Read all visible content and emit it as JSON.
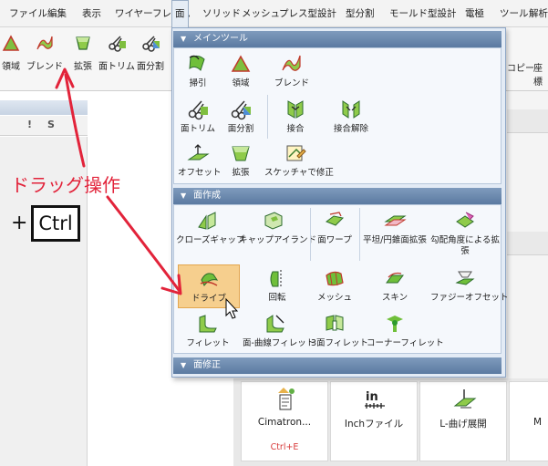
{
  "menubar": {
    "items": [
      {
        "label": "ファイル"
      },
      {
        "label": "編集"
      },
      {
        "label": "表示"
      },
      {
        "label": "ワイヤーフレーム"
      },
      {
        "label": "面"
      },
      {
        "label": "ソリッド"
      },
      {
        "label": "メッシュ"
      },
      {
        "label": "プレス型設計"
      },
      {
        "label": "型分割"
      },
      {
        "label": "モールド型設計"
      },
      {
        "label": "電極"
      },
      {
        "label": "ツール"
      },
      {
        "label": "解析"
      }
    ]
  },
  "ribbon": {
    "buttons": [
      {
        "label": "領域",
        "icon": "region-icon"
      },
      {
        "label": "ブレンド",
        "icon": "blend-icon"
      },
      {
        "label": "拡張",
        "icon": "extend-icon"
      },
      {
        "label": "面トリム",
        "icon": "face-trim-icon"
      },
      {
        "label": "面分割",
        "icon": "face-split-icon"
      }
    ],
    "right_label": "コピー",
    "right_label2": "座標"
  },
  "left_panel": {
    "tools": [
      "!",
      "S"
    ]
  },
  "dropdown": {
    "sections": [
      {
        "title": "メインツール",
        "items": [
          {
            "label": "掃引",
            "icon": "sweep-icon"
          },
          {
            "label": "領域",
            "icon": "region-icon"
          },
          {
            "label": "ブレンド",
            "icon": "blend-icon"
          },
          {
            "label": "面トリム",
            "icon": "face-trim-icon"
          },
          {
            "label": "面分割",
            "icon": "face-split-icon"
          },
          {
            "label": "接合",
            "icon": "stitch-icon"
          },
          {
            "label": "接合解除",
            "icon": "unstitch-icon"
          },
          {
            "label": "オフセット",
            "icon": "offset-icon"
          },
          {
            "label": "拡張",
            "icon": "extend-icon"
          },
          {
            "label": "スケッチャで修正",
            "icon": "sketcher-edit-icon"
          }
        ]
      },
      {
        "title": "面作成",
        "items": [
          {
            "label": "クローズギャップ",
            "icon": "close-gap-icon"
          },
          {
            "label": "キャップアイランド",
            "icon": "cap-island-icon"
          },
          {
            "label": "面ワープ",
            "icon": "face-warp-icon"
          },
          {
            "label": "平坦/円錐面拡張",
            "icon": "flat-cone-extend-icon"
          },
          {
            "label": "勾配角度による拡張",
            "icon": "draft-extend-icon"
          },
          {
            "label": "ドライブ",
            "icon": "drive-icon"
          },
          {
            "label": "回転",
            "icon": "revolve-icon"
          },
          {
            "label": "メッシュ",
            "icon": "mesh-icon"
          },
          {
            "label": "スキン",
            "icon": "skin-icon"
          },
          {
            "label": "ファジーオフセット",
            "icon": "fuzzy-offset-icon"
          },
          {
            "label": "フィレット",
            "icon": "fillet-icon"
          },
          {
            "label": "面-曲線フィレット",
            "icon": "face-curve-fillet-icon"
          },
          {
            "label": "3面フィレット",
            "icon": "three-face-fillet-icon"
          },
          {
            "label": "コーナーフィレット",
            "icon": "corner-fillet-icon"
          }
        ]
      },
      {
        "title": "面修正",
        "items": []
      }
    ]
  },
  "cards": [
    {
      "label": "Cimatron...",
      "shortcut": "Ctrl+E",
      "icon": "cimatron-icon"
    },
    {
      "label": "Inchファイル",
      "shortcut": "",
      "icon": "inch-file-icon"
    },
    {
      "label": "L-曲げ展開",
      "shortcut": "",
      "icon": "l-bend-unfold-icon"
    },
    {
      "label": "M",
      "shortcut": "",
      "icon": "m-icon"
    }
  ],
  "annotation": {
    "drag_text": "ドラッグ操作",
    "plus": "+",
    "ctrl": "Ctrl"
  },
  "colors": {
    "annotation_red": "#e2233a",
    "section_header": "#6b88ae",
    "highlight": "#f6cf8e",
    "shortcut_red": "#d83b3b"
  }
}
